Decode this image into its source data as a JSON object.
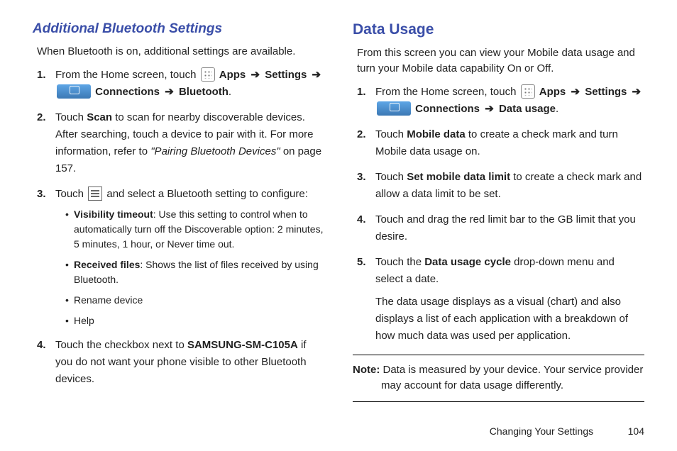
{
  "left": {
    "heading": "Additional Bluetooth Settings",
    "intro": "When Bluetooth is on, additional settings are available.",
    "step1_a": "From the Home screen, touch ",
    "apps": "Apps",
    "settings": "Settings",
    "connections": "Connections",
    "bluetooth": "Bluetooth",
    "step2_a": "Touch ",
    "scan": "Scan",
    "step2_b": " to scan for nearby discoverable devices. After searching, touch a device to pair with it. For more information, refer to ",
    "step2_ref": "\"Pairing Bluetooth Devices\"",
    "step2_c": " on page 157.",
    "step3_a": "Touch ",
    "step3_b": " and select a Bluetooth setting to configure:",
    "sub1_t": "Visibility timeout",
    "sub1_b": ": Use this setting to control when to automatically turn off the Discoverable option: 2 minutes, 5 minutes, 1 hour, or Never time out.",
    "sub2_t": "Received files",
    "sub2_b": ": Shows the list of files received by using Bluetooth.",
    "sub3": "Rename device",
    "sub4": "Help",
    "step4_a": "Touch the checkbox next to ",
    "model": "SAMSUNG-SM-C105A",
    "step4_b": " if you do not want your phone visible to other Bluetooth devices."
  },
  "right": {
    "heading": "Data Usage",
    "intro": "From this screen you can view your Mobile data usage and turn your Mobile data capability On or Off.",
    "step1_a": "From the Home screen, touch ",
    "apps": "Apps",
    "settings": "Settings",
    "connections": "Connections",
    "datausage": "Data usage",
    "step2_a": "Touch ",
    "mobiledata": "Mobile data",
    "step2_b": " to create a check mark and turn Mobile data usage on.",
    "step3_a": "Touch ",
    "setlimit": "Set mobile data limit",
    "step3_b": " to create a check mark and allow a data limit to be set.",
    "step4": "Touch and drag the red limit bar to the GB limit that you desire.",
    "step5_a": "Touch the ",
    "cycle": "Data usage cycle",
    "step5_b": " drop-down menu and select a date.",
    "step5_c": "The data usage displays as a visual (chart) and also displays a list of each application with a breakdown of how much data was used per application.",
    "note_label": "Note:",
    "note": " Data is measured by your device. Your service provider may account for data usage differently."
  },
  "footer": {
    "section": "Changing Your Settings",
    "page": "104"
  }
}
